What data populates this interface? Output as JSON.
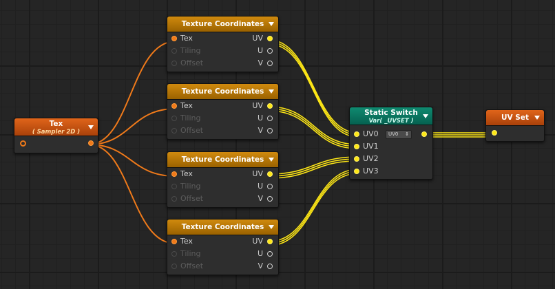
{
  "nodes": {
    "tex": {
      "title": "Tex",
      "subtitle": "( Sampler 2D )"
    },
    "texture_coordinates": {
      "title": "Texture Coordinates",
      "inputs": [
        "Tex",
        "Tiling",
        "Offset"
      ],
      "outputs": [
        "UV",
        "U",
        "V"
      ]
    },
    "static_switch": {
      "title": "Static Switch",
      "subtitle": "Var( _UVSET )",
      "inputs": [
        "UV0",
        "UV1",
        "UV2",
        "UV3"
      ],
      "dropdown_value": "UV0"
    },
    "uv_set": {
      "title": "UV Set"
    }
  },
  "icons": {
    "collapse": "triangle-down-icon",
    "dropdown_arrows": "updown-arrows-icon"
  },
  "colors": {
    "texture_coordinates_header": "#c07c0a",
    "tex_header": "#d0581a",
    "static_switch_header": "#0b7a63",
    "uv_set_header": "#d0581a",
    "sampler_wire": "#f07a1a",
    "vector_wire": "#ffe816"
  }
}
